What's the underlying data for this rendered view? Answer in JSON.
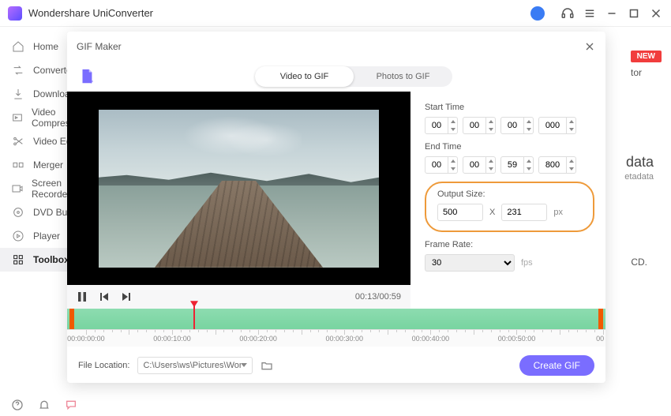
{
  "titlebar": {
    "app_name": "Wondershare UniConverter"
  },
  "sidebar": {
    "items": [
      {
        "id": "home",
        "label": "Home"
      },
      {
        "id": "converter",
        "label": "Converter"
      },
      {
        "id": "downloader",
        "label": "Downloader"
      },
      {
        "id": "video-compressor",
        "label": "Video Compressor"
      },
      {
        "id": "video-editor",
        "label": "Video Editor"
      },
      {
        "id": "merger",
        "label": "Merger"
      },
      {
        "id": "screen-recorder",
        "label": "Screen Recorder"
      },
      {
        "id": "dvd-burner",
        "label": "DVD Burner"
      },
      {
        "id": "player",
        "label": "Player"
      },
      {
        "id": "toolbox",
        "label": "Toolbox"
      }
    ]
  },
  "background": {
    "new_badge": "NEW",
    "word_tor": "tor",
    "word_data": "data",
    "word_tdata": "etadata",
    "word_cd": "CD."
  },
  "modal": {
    "title": "GIF Maker",
    "tabs": {
      "a": "Video to GIF",
      "b": "Photos to GIF"
    },
    "start_time_label": "Start Time",
    "end_time_label": "End Time",
    "start": {
      "h": "00",
      "m": "00",
      "s": "00",
      "ms": "000"
    },
    "end": {
      "h": "00",
      "m": "00",
      "s": "59",
      "ms": "800"
    },
    "output_label": "Output Size:",
    "output": {
      "w": "500",
      "h": "231",
      "sep": "X",
      "unit": "px"
    },
    "frame_rate_label": "Frame Rate:",
    "frame_rate": {
      "value": "30",
      "unit": "fps"
    },
    "playback": {
      "current": "00:13",
      "total": "00:59"
    },
    "timeline": {
      "labels": [
        "00:00:00:00",
        "00:00:10:00",
        "00:00:20:00",
        "00:00:30:00",
        "00:00:40:00",
        "00:00:50:00",
        "00"
      ]
    },
    "footer": {
      "file_location_label": "File Location:",
      "path_display": "C:\\Users\\ws\\Pictures\\Wonders",
      "create_label": "Create GIF"
    }
  }
}
